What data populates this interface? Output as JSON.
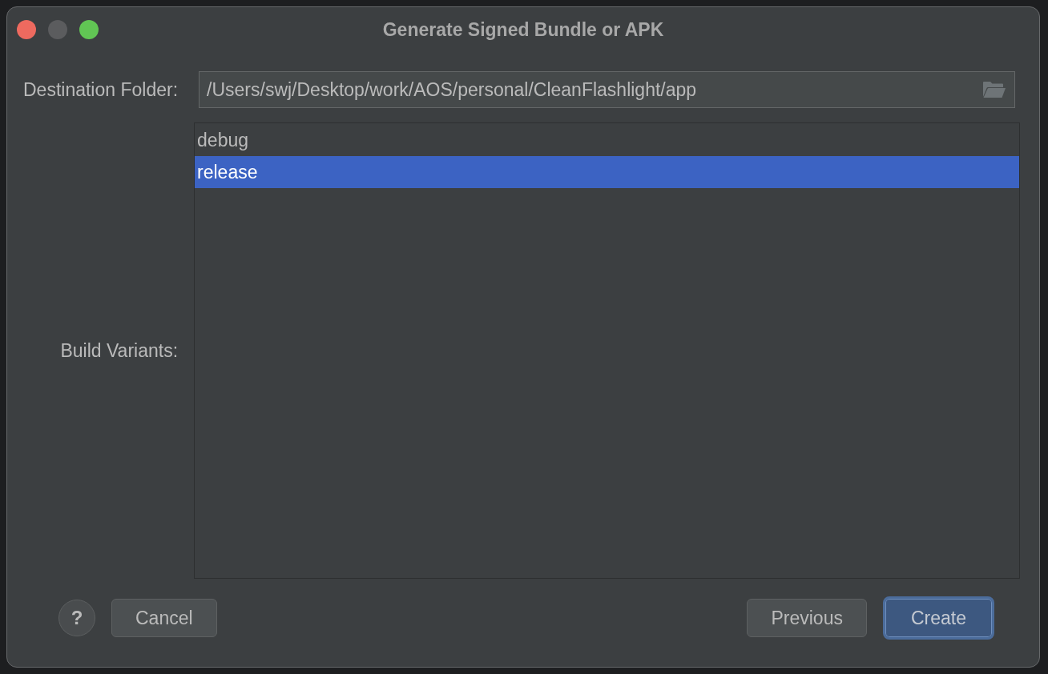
{
  "window": {
    "title": "Generate Signed Bundle or APK",
    "controls": [
      {
        "kind": "close",
        "disabled": false
      },
      {
        "kind": "minimize",
        "disabled": true
      },
      {
        "kind": "zoom",
        "disabled": false
      }
    ]
  },
  "destination_folder": {
    "label": "Destination Folder:",
    "value": "/Users/swj/Desktop/work/AOS/personal/CleanFlashlight/app"
  },
  "build_variants": {
    "label": "Build Variants:",
    "items": [
      {
        "label": "debug",
        "selected": false
      },
      {
        "label": "release",
        "selected": true
      }
    ]
  },
  "footer": {
    "left": [
      {
        "kind": "help",
        "label": "?"
      },
      {
        "kind": "normal",
        "label": "Cancel"
      }
    ],
    "right": [
      {
        "kind": "normal",
        "label": "Previous"
      },
      {
        "kind": "default",
        "label": "Create"
      }
    ]
  }
}
